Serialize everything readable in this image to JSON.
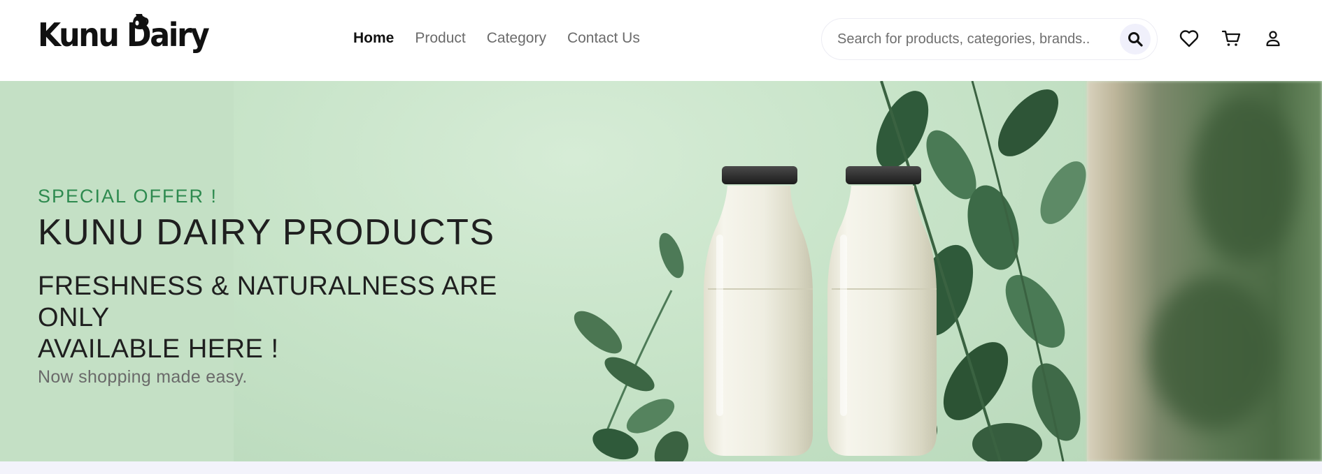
{
  "brand": {
    "name": "Kunu Dairy",
    "logo_icon": "milk-jug-icon"
  },
  "nav": {
    "items": [
      {
        "label": "Home",
        "active": true
      },
      {
        "label": "Product",
        "active": false
      },
      {
        "label": "Category",
        "active": false
      },
      {
        "label": "Contact Us",
        "active": false
      }
    ]
  },
  "search": {
    "placeholder": "Search for products, categories, brands..",
    "value": "",
    "icon": "search-icon"
  },
  "header_icons": {
    "wishlist": "heart-icon",
    "cart": "cart-icon",
    "account": "user-icon"
  },
  "hero": {
    "offer": "SPECIAL OFFER !",
    "title": "KUNU DAIRY PRODUCTS",
    "subtitle_line1": "FRESHNESS & NATURALNESS ARE ONLY",
    "subtitle_line2": "AVAILABLE HERE !",
    "tagline": "Now shopping made easy."
  },
  "colors": {
    "accent": "#2e8a4f",
    "hero_bg": "#c8e4c9",
    "text": "#1f1f1f",
    "muted": "#6a6a6a"
  }
}
